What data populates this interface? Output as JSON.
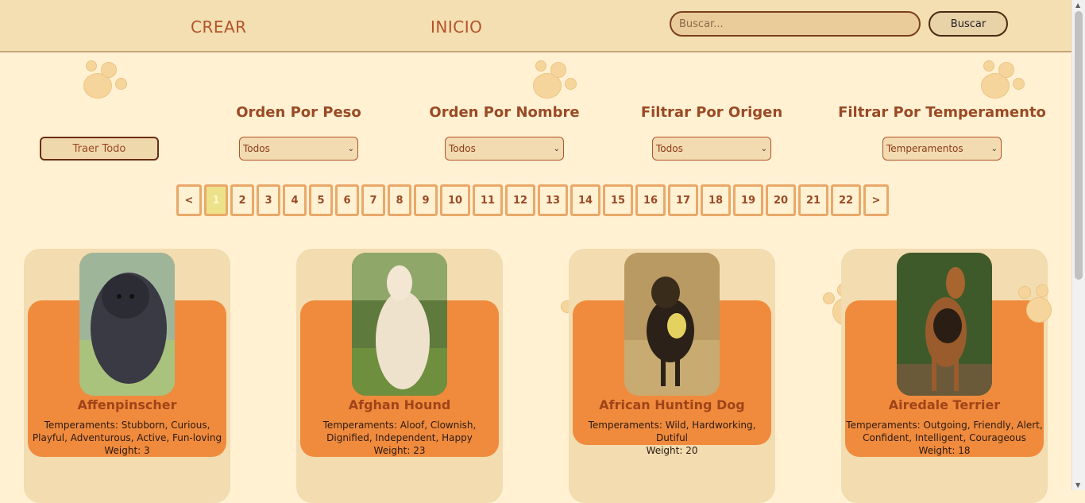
{
  "nav": {
    "crear": "CREAR",
    "inicio": "INICIO"
  },
  "search": {
    "placeholder": "Buscar...",
    "button": "Buscar"
  },
  "filters": {
    "traer_todo": "Traer Todo",
    "peso": {
      "title": "Orden Por Peso",
      "selected": "Todos"
    },
    "nombre": {
      "title": "Orden Por Nombre",
      "selected": "Todos"
    },
    "origen": {
      "title": "Filtrar Por Origen",
      "selected": "Todos"
    },
    "temperamento": {
      "title": "Filtrar Por Temperamento",
      "selected": "Temperamentos"
    }
  },
  "pagination": {
    "prev": "<",
    "next": ">",
    "current": "1",
    "pages": [
      "1",
      "2",
      "3",
      "4",
      "5",
      "6",
      "7",
      "8",
      "9",
      "10",
      "11",
      "12",
      "13",
      "14",
      "15",
      "16",
      "17",
      "18",
      "19",
      "20",
      "21",
      "22"
    ]
  },
  "cards": [
    {
      "name": "Affenpinscher",
      "temperaments": "Temperaments: Stubborn, Curious, Playful, Adventurous, Active, Fun-loving",
      "weight": "Weight: 3"
    },
    {
      "name": "Afghan Hound",
      "temperaments": "Temperaments: Aloof, Clownish, Dignified, Independent, Happy",
      "weight": "Weight: 23"
    },
    {
      "name": "African Hunting Dog",
      "temperaments": "Temperaments: Wild, Hardworking, Dutiful",
      "weight": "Weight: 20"
    },
    {
      "name": "Airedale Terrier",
      "temperaments": "Temperaments: Outgoing, Friendly, Alert, Confident, Intelligent, Courageous",
      "weight": "Weight: 18"
    }
  ],
  "colors": {
    "accent": "#f08b3e",
    "brand_text": "#b4532a",
    "background": "#fff1d2",
    "header": "#f3dfb1"
  }
}
